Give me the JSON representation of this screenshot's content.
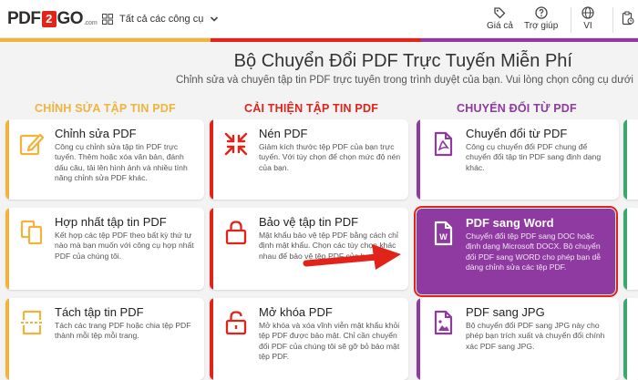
{
  "header": {
    "logo": {
      "pdf": "PDF",
      "two": "2",
      "go": "GO",
      "com": ".com"
    },
    "tools_label": "Tất cả các công cụ",
    "pricing_label": "Giá cả",
    "help_label": "Trợ giúp",
    "lang_label": "VI"
  },
  "page": {
    "title": "Bộ Chuyển Đổi PDF Trực Tuyến Miễn Phí",
    "subtitle": "Chỉnh sửa và chuyển tập tin PDF trực tuyến trong trình duyệt của bạn. Vui lòng chọn công cụ dưới"
  },
  "columns": [
    {
      "title": "CHỈNH SỬA TẬP TIN PDF",
      "color": "#f0b43c"
    },
    {
      "title": "CẢI THIỆN TẬP TIN PDF",
      "color": "#e2231a"
    },
    {
      "title": "CHUYỂN ĐỔI TỪ PDF",
      "color": "#8e3aa0"
    }
  ],
  "cards": [
    {
      "title": "Chỉnh sửa PDF",
      "desc": "Công cụ chỉnh sửa tập tin PDF trực tuyến. Thêm hoặc xóa văn bản, đánh dấu câu, tải lên hình ảnh và nhiều tính năng chỉnh sửa PDF khác.",
      "icon": "edit-icon"
    },
    {
      "title": "Nén PDF",
      "desc": "Giảm kích thước tệp PDF của bạn trực tuyến. Với tùy chọn để chọn mức độ nén của bạn.",
      "icon": "compress-icon"
    },
    {
      "title": "Chuyển đổi từ PDF",
      "desc": "Công cụ chuyển đổi PDF chung để chuyển đổi tập tin PDF sang định dạng khác.",
      "icon": "pdf-file-icon"
    },
    {
      "title": "Hợp nhất tập tin PDF",
      "desc": "Kết hợp các tệp PDF theo bất kỳ thứ tự nào mà bạn muốn với công cụ hợp nhất PDF của chúng tôi.",
      "icon": "merge-icon"
    },
    {
      "title": "Bảo vệ tập tin PDF",
      "desc": "Mật khẩu bảo vệ tệp PDF bằng cách chỉ định mật khẩu. Chọn các tùy chọn khác nhau để bảo vệ tệp PDF của bạn.",
      "icon": "lock-icon"
    },
    {
      "title": "PDF sang Word",
      "desc": "Chuyển đổi tệp PDF sang DOC hoặc định dạng Microsoft DOCX. Bộ chuyển đổi PDF sang WORD cho phép bạn dễ dàng chỉnh sửa các tệp PDF.",
      "icon": "word-file-icon"
    },
    {
      "title": "Tách tập tin PDF",
      "desc": "Tách các trang PDF hoặc chia tệp PDF thành mỗi tệp mỗi trang.",
      "icon": "split-icon"
    },
    {
      "title": "Mở khóa PDF",
      "desc": "Mở khóa và xóa vĩnh viễn mật khẩu khỏi tệp PDF được bảo mật. Chỉ cần chuyển đổi PDF của chúng tôi sẽ gỡ bỏ bảo mật tệp PDF.",
      "icon": "unlock-icon"
    },
    {
      "title": "PDF sang JPG",
      "desc": "Bộ chuyển đổi PDF sang JPG này cho phép bạn trích xuất và chuyển đổi chính xác PDF sang JPG.",
      "icon": "image-file-icon"
    }
  ]
}
